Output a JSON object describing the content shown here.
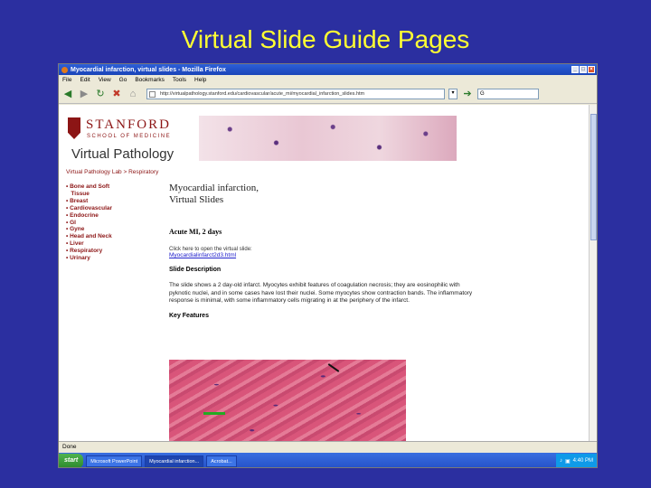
{
  "slide_title": "Virtual Slide Guide Pages",
  "window": {
    "title": "Myocardial infarction, virtual slides - Mozilla Firefox",
    "buttons": [
      "_",
      "□",
      "×"
    ]
  },
  "menu": [
    "File",
    "Edit",
    "View",
    "Go",
    "Bookmarks",
    "Tools",
    "Help"
  ],
  "toolbar": {
    "url": "http://virtualpathology.stanford.edu/cardiovascular/acute_mi/myocardial_infarction_slides.htm",
    "search_value": "G"
  },
  "page": {
    "logo_line1": "STANFORD",
    "logo_line2": "SCHOOL OF MEDICINE",
    "site_title": "Virtual Pathology",
    "breadcrumb": "Virtual Pathology Lab > Respiratory",
    "nav": [
      "• Bone and Soft",
      "   Tissue",
      "• Breast",
      "• Cardiovascular",
      "• Endocrine",
      "• GI",
      "• Gyne",
      "• Head and Neck",
      "• Liver",
      "• Respiratory",
      "• Urinary"
    ],
    "content_title_line1": "Myocardial infarction,",
    "content_title_line2": "Virtual Slides",
    "subheading": "Acute MI, 2 days",
    "click_text": "Click here to open the virtual slide:",
    "link_text": "Myocardialinfarct2d3.html",
    "slide_desc_heading": "Slide Description",
    "slide_desc": "The slide shows a 2 day-old infarct. Myocytes exhibit features of coagulation necrosis; they are eosinophilic with pyknotic nuclei, and in some cases have lost their nuclei. Some myocytes show contraction bands. The inflammatory response is minimal, with some inflammatory cells migrating in at the periphery of the infarct.",
    "key_features_heading": "Key Features"
  },
  "status": "Done",
  "taskbar": {
    "start": "start",
    "items": [
      "Microsoft PowerPoint",
      "Myocardial infarction...",
      "Acrobat..."
    ],
    "clock": "4:40 PM"
  }
}
